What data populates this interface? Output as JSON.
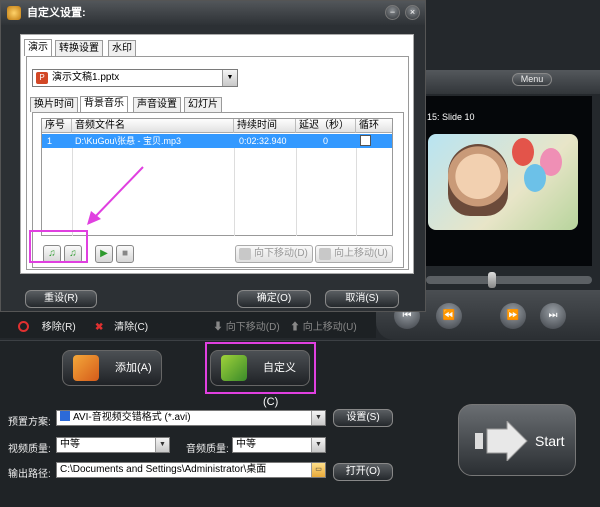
{
  "dialog": {
    "title": "自定义设置:",
    "tabs": [
      "演示",
      "转换设置",
      "水印"
    ],
    "file_select_value": "演示文稿1.pptx",
    "subtabs": [
      "换片时间",
      "背景音乐",
      "声音设置",
      "幻灯片"
    ],
    "grid": {
      "headers": [
        "序号",
        "音频文件名",
        "持续时间",
        "延迟（秒）",
        "循环"
      ],
      "rows": [
        {
          "index": "1",
          "file": "D:\\KuGou\\张悬 - 宝贝.mp3",
          "duration": "0:02:32.940",
          "delay": "0"
        }
      ]
    },
    "move_down_label": "向下移动(D)",
    "move_up_label": "向上移动(U)",
    "reset_label": "重设(R)",
    "ok_label": "确定(O)",
    "cancel_label": "取消(S)"
  },
  "main": {
    "menu_label": "Menu",
    "slide_label": "15: Slide 10",
    "toolbar": {
      "remove_label": "移除(R)",
      "clear_label": "清除(C)",
      "move_down_label": "向下移动(D)",
      "move_up_label": "向上移动(U)"
    },
    "add_label": "添加(A)",
    "custom_label": "自定义(C)",
    "preset_label": "预置方案:",
    "preset_value": "AVI-音视频交错格式 (*.avi)",
    "settings_label": "设置(S)",
    "video_quality_label": "视频质量:",
    "video_quality_value": "中等",
    "audio_quality_label": "音频质量:",
    "audio_quality_value": "中等",
    "output_path_label": "输出路径:",
    "output_path_value": "C:\\Documents and Settings\\Administrator\\桌面",
    "open_label": "打开(O)",
    "start_label": "Start"
  },
  "colors": {
    "highlight": "#e040e0",
    "selection": "#3399ff"
  }
}
